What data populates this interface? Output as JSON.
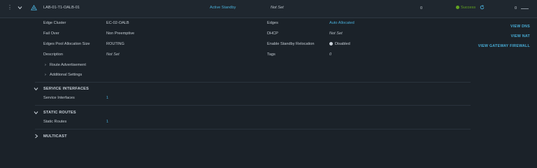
{
  "gateway": {
    "name": "LAB-01-T1-OALB-01",
    "ha_mode": "Active Standby",
    "failover_state": "Not Set",
    "count": "0",
    "status": "Success",
    "alarms": "0",
    "status_color": "#62a420"
  },
  "details_left": [
    {
      "label": "Edge Cluster",
      "value": "EC-02-OALB"
    },
    {
      "label": "Fail Over",
      "value": "Non Preemptive"
    },
    {
      "label": "Edges Pool Allocation Size",
      "value": "ROUTING"
    },
    {
      "label": "Description",
      "value": "Not Set"
    }
  ],
  "details_right": [
    {
      "label": "Edges",
      "value": "Auto Allocated"
    },
    {
      "label": "DHCP",
      "value": "Not Set"
    },
    {
      "label": "Enable Standby Relocation",
      "value": "Disabled"
    },
    {
      "label": "Tags",
      "value": "0"
    }
  ],
  "expanders": {
    "route_advertisement": "Route Advertisement",
    "additional_settings": "Additional Settings"
  },
  "actions": {
    "view_dns": "VIEW DNS",
    "view_nat": "VIEW NAT",
    "view_gateway_firewall": "VIEW GATEWAY FIREWALL"
  },
  "sections": {
    "service_interfaces": {
      "title": "SERVICE INTERFACES",
      "label": "Service Interfaces",
      "value": "1"
    },
    "static_routes": {
      "title": "STATIC ROUTES",
      "label": "Static Routes",
      "value": "1"
    },
    "multicast": {
      "title": "MULTICAST"
    }
  }
}
